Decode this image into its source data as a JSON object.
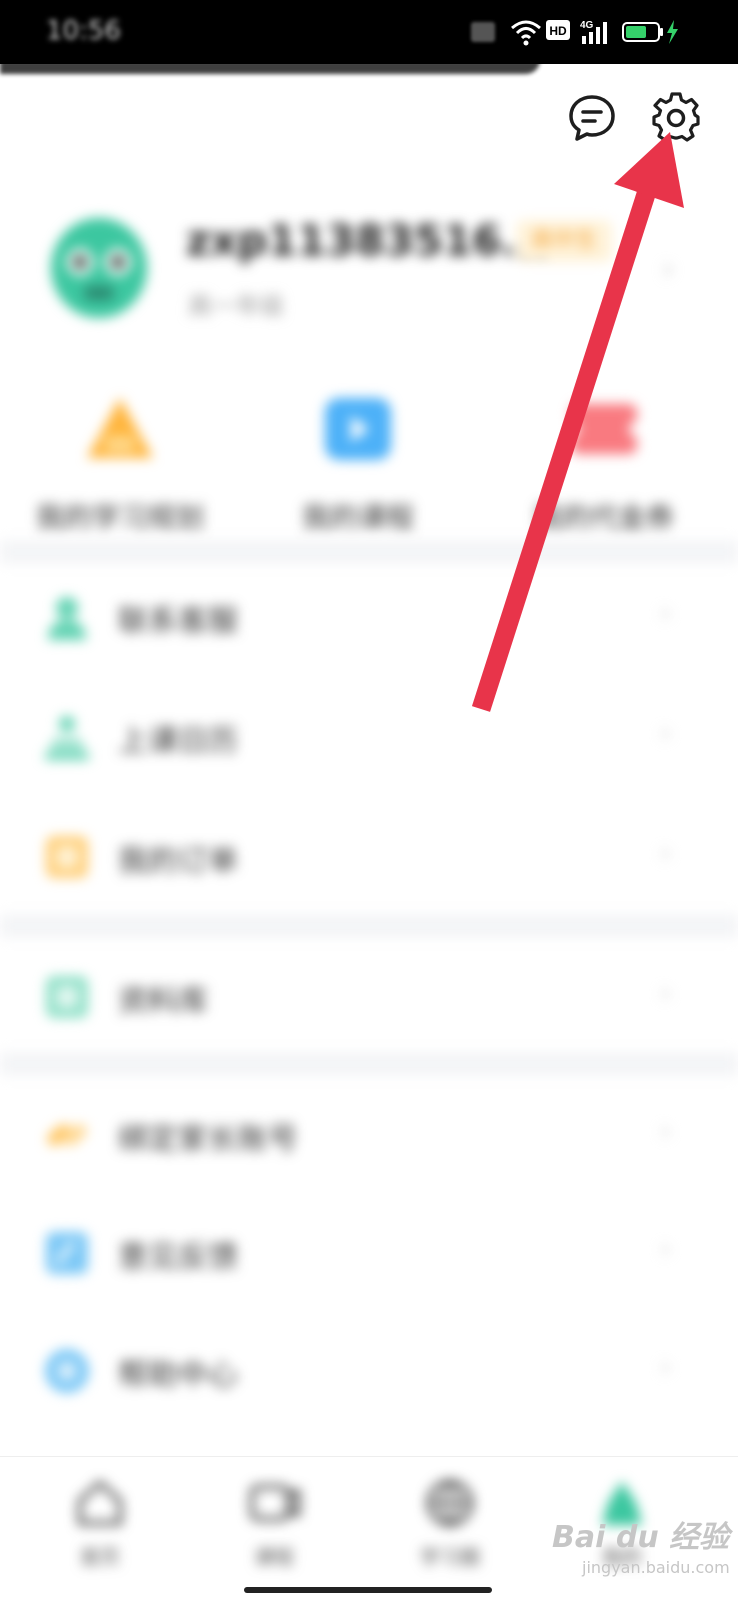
{
  "colors": {
    "accent_green": "#3cc7a0",
    "badge_orange": "#f4a53a",
    "arrow_red": "#e8344a",
    "list_icon_teal": "#63d3b3",
    "list_icon_orange": "#ffcf7a",
    "list_icon_blue": "#7cc8f6"
  },
  "status_bar": {
    "time": "10:56",
    "icons": [
      "sim-icon",
      "wifi-icon",
      "hd-icon",
      "signal-4g-icon",
      "battery-charging-icon"
    ],
    "hd_label": "HD",
    "net_label": "4G"
  },
  "top_actions": {
    "message_icon": "message-icon",
    "settings_icon": "gear-icon"
  },
  "profile": {
    "username": "zxp11383516...",
    "badge": "高中生",
    "subtitle": "高一年级"
  },
  "quick_actions": [
    {
      "label": "我的学习规划",
      "icon": "study-plan-icon",
      "color": "#ffb53d"
    },
    {
      "label": "我的课程",
      "icon": "course-play-icon",
      "color": "#4db1f8"
    },
    {
      "label": "我的代金券",
      "icon": "coupon-icon",
      "color": "#f97a80"
    }
  ],
  "menu_groups": [
    [
      {
        "label": "联系客服",
        "icon": "customer-service-icon"
      },
      {
        "label": "上课日历",
        "icon": "calendar-icon"
      },
      {
        "label": "我的订单",
        "icon": "order-icon"
      }
    ],
    [
      {
        "label": "资料库",
        "icon": "library-icon"
      }
    ],
    [
      {
        "label": "绑定家长账号",
        "icon": "link-icon"
      },
      {
        "label": "意见反馈",
        "icon": "feedback-icon"
      },
      {
        "label": "帮助中心",
        "icon": "help-icon"
      }
    ]
  ],
  "bottom_nav": [
    {
      "label": "首页",
      "icon": "home-icon"
    },
    {
      "label": "课程",
      "icon": "course-icon"
    },
    {
      "label": "学习圈",
      "icon": "community-icon"
    },
    {
      "label": "我的",
      "icon": "profile-icon"
    }
  ],
  "watermark": {
    "main": "Bai du 经验",
    "sub": "jingyan.baidu.com"
  }
}
